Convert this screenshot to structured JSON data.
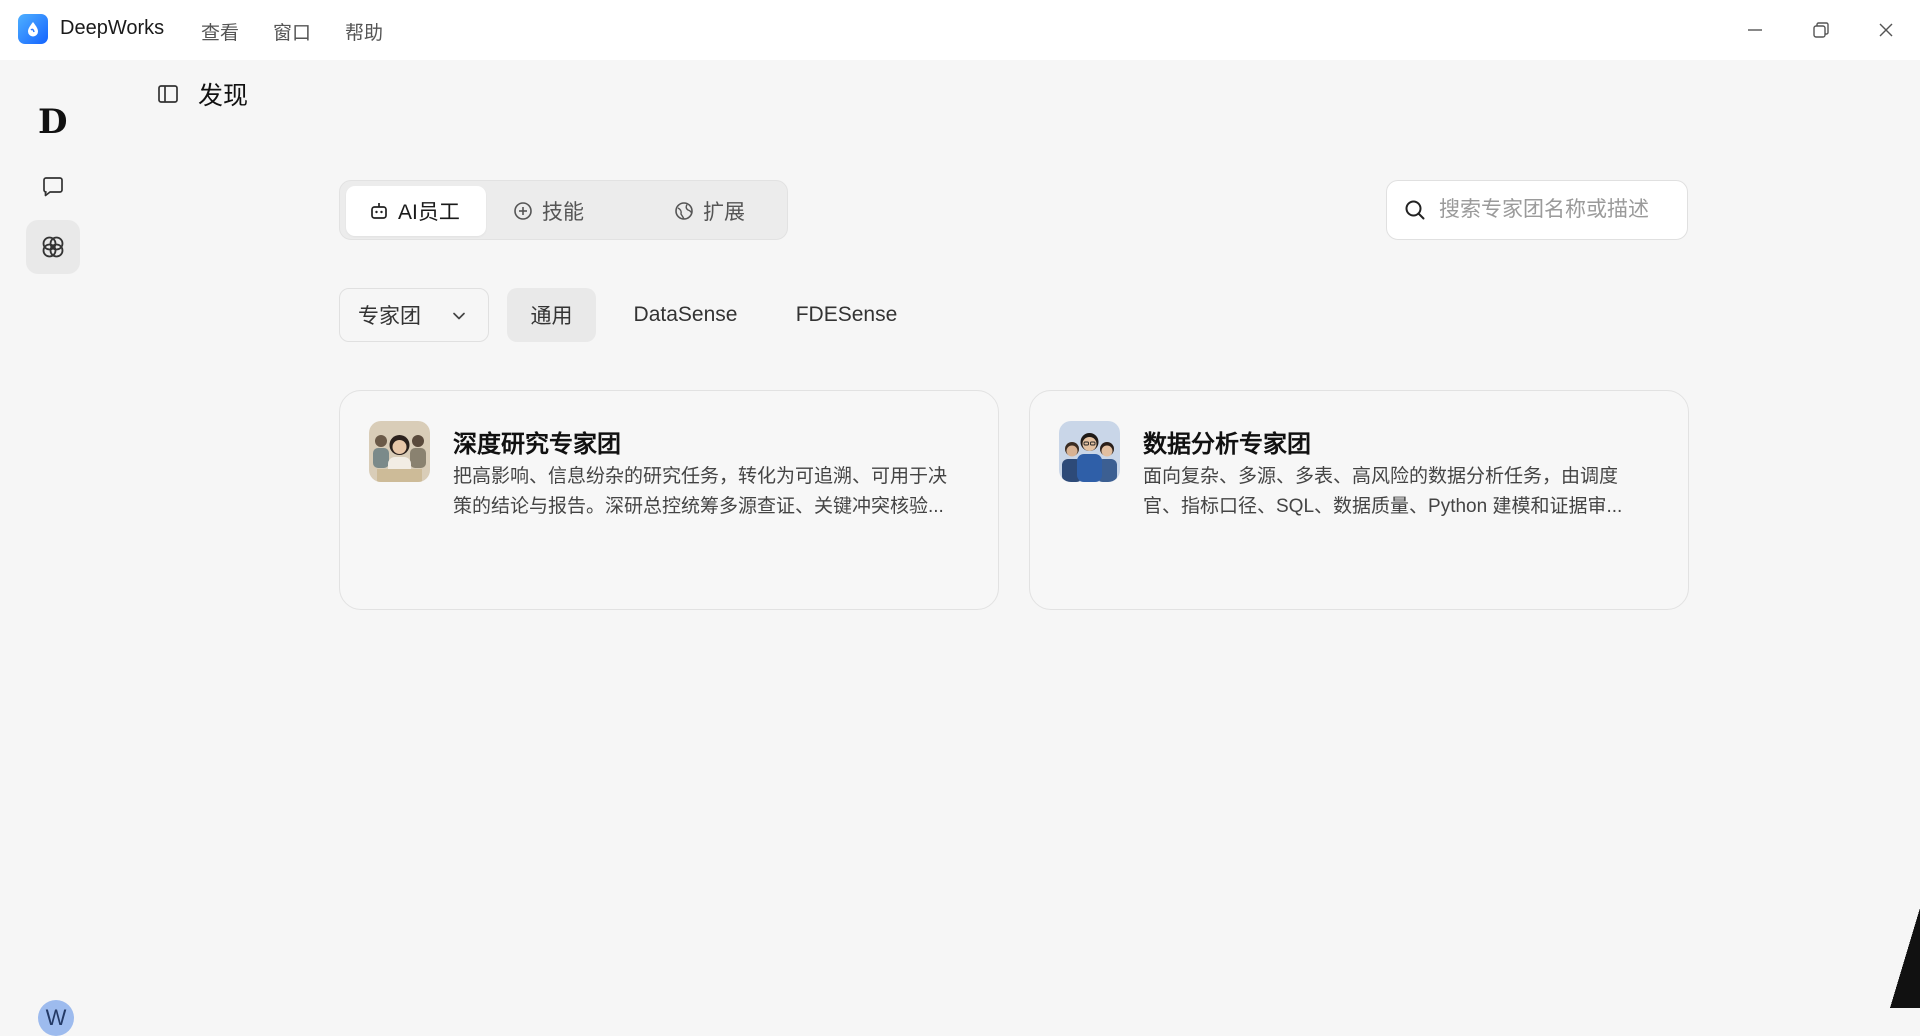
{
  "app": {
    "name": "DeepWorks"
  },
  "menu": [
    {
      "label": "查看"
    },
    {
      "label": "窗口"
    },
    {
      "label": "帮助"
    }
  ],
  "rail": {
    "logo": "D",
    "avatar": "W"
  },
  "page": {
    "title": "发现"
  },
  "tabs": [
    {
      "label": "AI员工",
      "icon": "robot-icon",
      "active": true
    },
    {
      "label": "技能",
      "icon": "plus-circle-icon",
      "active": false
    },
    {
      "label": "扩展",
      "icon": "globe-icon",
      "active": false
    }
  ],
  "search": {
    "placeholder": "搜索专家团名称或描述"
  },
  "filters": {
    "dropdown": "专家团",
    "chips": [
      {
        "label": "通用",
        "active": true
      },
      {
        "label": "DataSense",
        "active": false
      },
      {
        "label": "FDESense",
        "active": false
      }
    ]
  },
  "cards": [
    {
      "title": "深度研究专家团",
      "description": "把高影响、信息纷杂的研究任务，转化为可追溯、可用于决策的结论与报告。深研总控统筹多源查证、关键冲突核验..."
    },
    {
      "title": "数据分析专家团",
      "description": "面向复杂、多源、多表、高风险的数据分析任务，由调度官、指标口径、SQL、数据质量、Python 建模和证据审..."
    }
  ],
  "colors": {
    "accent": "#1463ff",
    "background": "#f6f6f6",
    "avatar": "#9dbbee"
  }
}
